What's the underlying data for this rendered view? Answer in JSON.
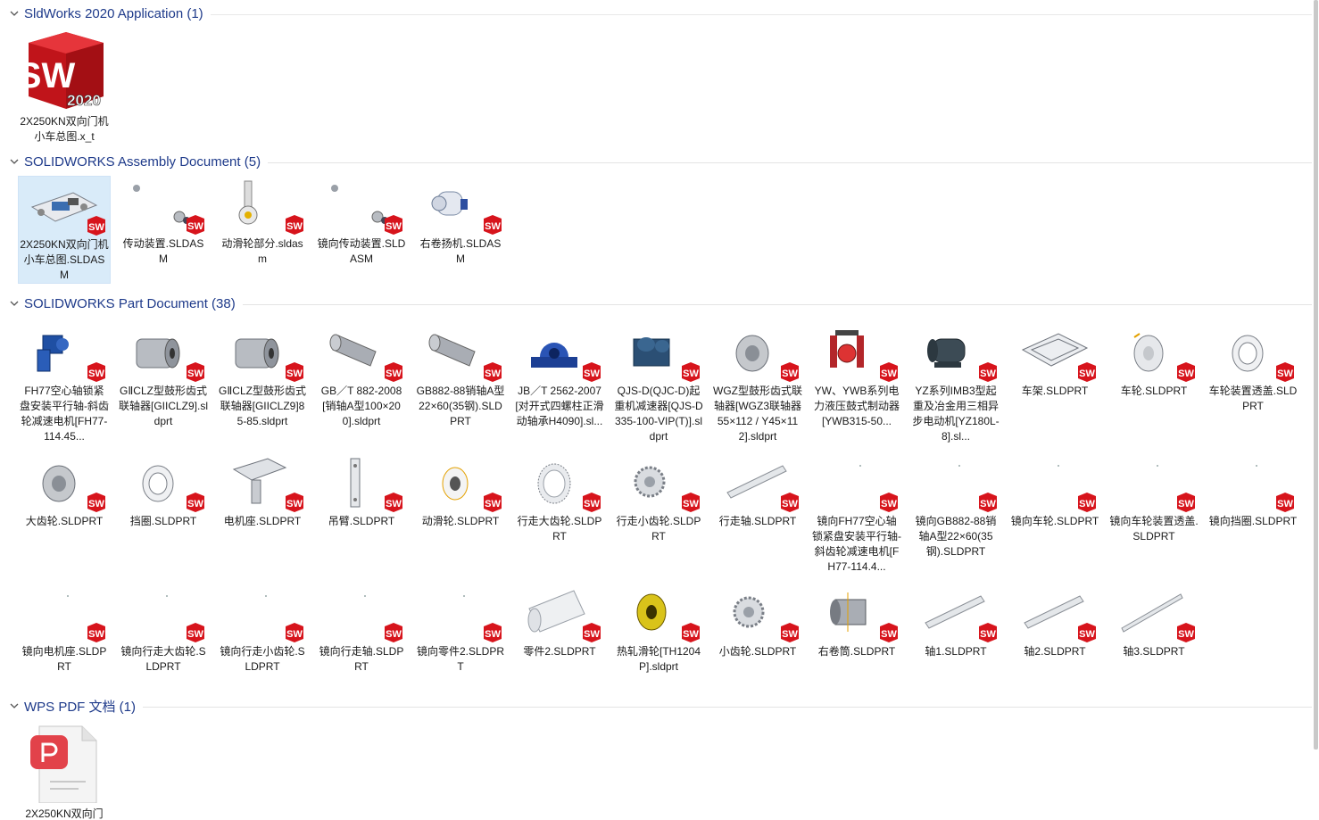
{
  "groups": [
    {
      "title": "SldWorks 2020 Application (1)",
      "items": [
        {
          "label": "2X250KN双向门机小车总图.x_t"
        }
      ]
    },
    {
      "title": "SOLIDWORKS Assembly Document (5)",
      "items": [
        {
          "label": "2X250KN双向门机小车总图.SLDASM"
        },
        {
          "label": "传动装置.SLDASM"
        },
        {
          "label": "动滑轮部分.sldasm"
        },
        {
          "label": "镜向传动装置.SLDASM"
        },
        {
          "label": "右卷扬机.SLDASM"
        }
      ]
    },
    {
      "title": "SOLIDWORKS Part Document (38)",
      "items": [
        {
          "label": "FH77空心轴锁紧盘安装平行轴-斜齿轮减速电机[FH77-114.45..."
        },
        {
          "label": "GⅡCLZ型鼓形齿式联轴器[GIICLZ9].sldprt"
        },
        {
          "label": "GⅡCLZ型鼓形齿式联轴器[GIICLZ9]85-85.sldprt"
        },
        {
          "label": "GB／T 882-2008[销轴A型100×200].sldprt"
        },
        {
          "label": "GB882-88销轴A型22×60(35钢).SLDPRT"
        },
        {
          "label": "JB／T 2562-2007[对开式四螺柱正滑动轴承H4090].sl..."
        },
        {
          "label": "QJS-D(QJC-D)起重机减速器[QJS-D335-100-VIP(T)].sldprt"
        },
        {
          "label": "WGZ型鼓形齿式联轴器[WGZ3联轴器55×112 / Y45×112].sldprt"
        },
        {
          "label": "YW、YWB系列电力液压鼓式制动器[YWB315-50..."
        },
        {
          "label": "YZ系列IMB3型起重及冶金用三相异步电动机[YZ180L-8].sl..."
        },
        {
          "label": "车架.SLDPRT"
        },
        {
          "label": "车轮.SLDPRT"
        },
        {
          "label": "车轮装置透盖.SLDPRT"
        },
        {
          "label": "大齿轮.SLDPRT"
        },
        {
          "label": "挡圈.SLDPRT"
        },
        {
          "label": "电机座.SLDPRT"
        },
        {
          "label": "吊臂.SLDPRT"
        },
        {
          "label": "动滑轮.SLDPRT"
        },
        {
          "label": "行走大齿轮.SLDPRT"
        },
        {
          "label": "行走小齿轮.SLDPRT"
        },
        {
          "label": "行走轴.SLDPRT"
        },
        {
          "label": "镜向FH77空心轴锁紧盘安装平行轴-斜齿轮减速电机[FH77-114.4..."
        },
        {
          "label": "镜向GB882-88销轴A型22×60(35钢).SLDPRT"
        },
        {
          "label": "镜向车轮.SLDPRT"
        },
        {
          "label": "镜向车轮装置透盖.SLDPRT"
        },
        {
          "label": "镜向挡圈.SLDPRT"
        },
        {
          "label": "镜向电机座.SLDPRT"
        },
        {
          "label": "镜向行走大齿轮.SLDPRT"
        },
        {
          "label": "镜向行走小齿轮.SLDPRT"
        },
        {
          "label": "镜向行走轴.SLDPRT"
        },
        {
          "label": "镜向零件2.SLDPRT"
        },
        {
          "label": "零件2.SLDPRT"
        },
        {
          "label": "热轧滑轮[TH1204P].sldprt"
        },
        {
          "label": "小齿轮.SLDPRT"
        },
        {
          "label": "右卷筒.SLDPRT"
        },
        {
          "label": "轴1.SLDPRT"
        },
        {
          "label": "轴2.SLDPRT"
        },
        {
          "label": "轴3.SLDPRT"
        }
      ]
    },
    {
      "title": "WPS PDF 文档 (1)",
      "items": [
        {
          "label": "2X250KN双向门"
        }
      ]
    }
  ],
  "app_icon_text": {
    "letters": "SW",
    "version": "2020"
  },
  "colors": {
    "group_title": "#1e3a8a",
    "badge_red": "#d7141c",
    "selection": "#d9ebf9",
    "pdf_red": "#e2424a"
  }
}
